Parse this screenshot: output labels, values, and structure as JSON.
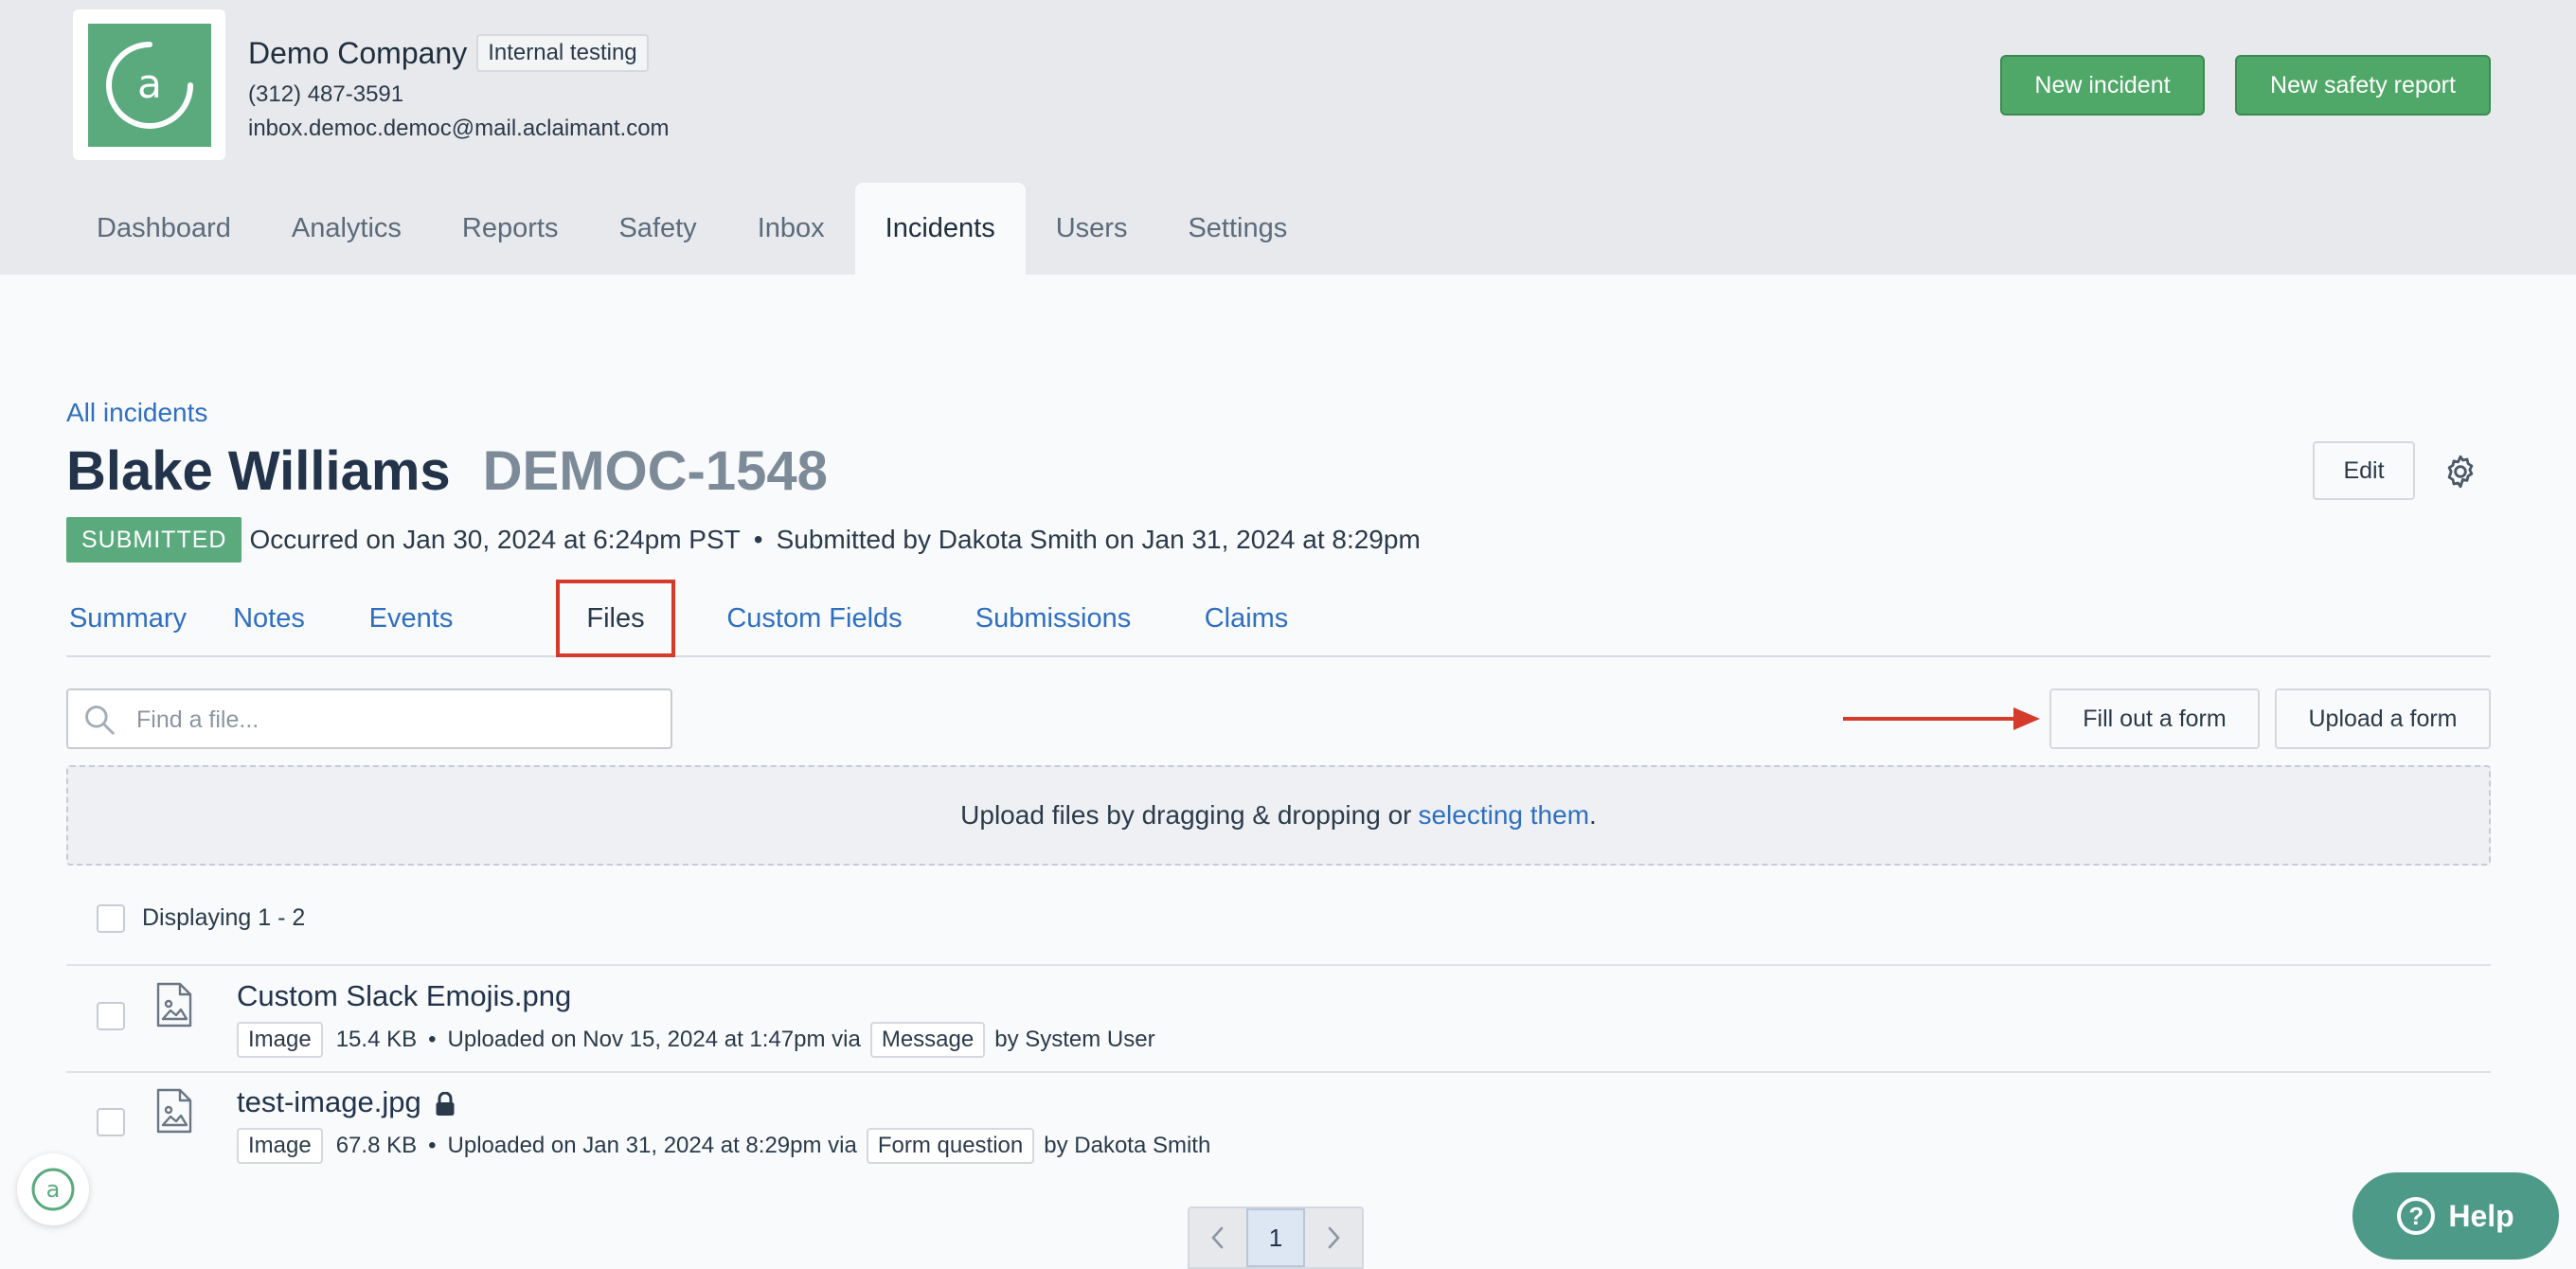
{
  "colors": {
    "brand_green": "#5aaa7e",
    "button_green": "#4fa868",
    "link_blue": "#2f6fc0",
    "highlight_red": "#d63a2a",
    "help_teal": "#4d9a89"
  },
  "company": {
    "logo_icon": "aclaimant-logo-icon",
    "name": "Demo Company",
    "badge": "Internal testing",
    "phone": "(312) 487-3591",
    "email": "inbox.democ.democ@mail.aclaimant.com"
  },
  "header_actions": {
    "new_incident": "New incident",
    "new_safety_report": "New safety report"
  },
  "nav": {
    "items": [
      "Dashboard",
      "Analytics",
      "Reports",
      "Safety",
      "Inbox",
      "Incidents",
      "Users",
      "Settings"
    ],
    "active": "Incidents"
  },
  "breadcrumb": "All incidents",
  "incident": {
    "name": "Blake Williams",
    "id": "DEMOC-1548",
    "status": "SUBMITTED",
    "occurred": "Occurred on Jan 30, 2024 at 6:24pm PST",
    "submitted": "Submitted by Dakota Smith on Jan 31, 2024 at 8:29pm",
    "separator": "•"
  },
  "actions": {
    "edit": "Edit",
    "settings_icon": "gear-icon"
  },
  "subtabs": {
    "items": [
      "Summary",
      "Notes",
      "Events",
      "Files",
      "Custom Fields",
      "Submissions",
      "Claims"
    ],
    "active": "Files"
  },
  "files": {
    "search_placeholder": "Find a file...",
    "search_value": "",
    "fill_out_form": "Fill out a form",
    "upload_form": "Upload a form",
    "dropzone_text": "Upload files by dragging & dropping or",
    "dropzone_link": "selecting them",
    "dropzone_end": ".",
    "displaying": "Displaying 1 - 2",
    "list": [
      {
        "name": "Custom Slack Emojis.png",
        "locked": false,
        "type": "Image",
        "size": "15.4 KB",
        "uploaded": "Uploaded on Nov 15, 2024 at 1:47pm via",
        "via": "Message",
        "by": "by System User"
      },
      {
        "name": "test-image.jpg",
        "locked": true,
        "type": "Image",
        "size": "67.8 KB",
        "uploaded": "Uploaded on Jan 31, 2024 at 8:29pm via",
        "via": "Form question",
        "by": "by Dakota Smith"
      }
    ]
  },
  "pagination": {
    "current": "1",
    "prev_icon": "chevron-left-icon",
    "next_icon": "chevron-right-icon"
  },
  "help": {
    "label": "Help",
    "icon_glyph": "?"
  }
}
